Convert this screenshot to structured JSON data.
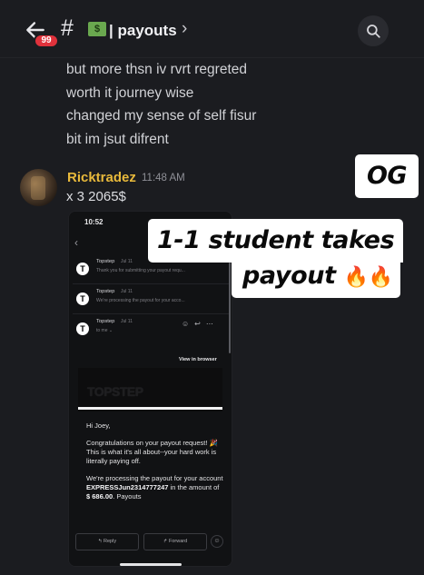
{
  "header": {
    "unread_badge": "99",
    "hash_symbol": "#",
    "channel_emoji": "💵",
    "channel_name": "| payouts",
    "chevron": "›"
  },
  "previous_message_lines": [
    "but more thsn iv rvrt regreted",
    "worth it journey wise",
    "changed my sense of self fisur",
    "bit im jsut difrent"
  ],
  "message": {
    "username": "Ricktradez",
    "timestamp": "11:48 AM",
    "text": "x 3 2065$",
    "username_color": "#e8b93b"
  },
  "phone_screenshot": {
    "time": "10:52",
    "emails": [
      {
        "sender": "Topstep",
        "date": "Jul 11",
        "snippet": "Thank you for submitting your payout requ..."
      },
      {
        "sender": "Topstep",
        "date": "Jul 11",
        "snippet": "We're processing the payout for your acco..."
      },
      {
        "sender": "Topstep",
        "date": "Jul 11",
        "snippet": "to me ⌄"
      }
    ],
    "view_in_browser": "View in browser",
    "banner_logo": "TOPSTEP",
    "email_body": {
      "greeting": "Hi Joey,",
      "para1": "Congratulations on your payout request! 🎉 This is what it's all about--your hard work is literally paying off.",
      "para2_prefix": "We're processing the payout for your account",
      "account_id": "EXPRESSJun2314777247",
      "para2_mid": "in the amount of",
      "amount": "$ 686.00",
      "para2_suffix": ". Payouts"
    },
    "reply_label": "Reply",
    "forward_label": "Forward"
  },
  "overlays": {
    "og_label": "OG",
    "caption_line1": "1-1 student takes",
    "caption_line2": "payout",
    "caption_emoji": "🔥🔥"
  },
  "colors": {
    "background": "#1b1c20",
    "badge": "#e0323c",
    "overlay_bg": "#ffffff"
  },
  "icons": [
    "back-arrow-icon",
    "search-icon",
    "money-emoji-icon",
    "reply-icon",
    "forward-icon",
    "emoji-icon",
    "more-icon"
  ]
}
